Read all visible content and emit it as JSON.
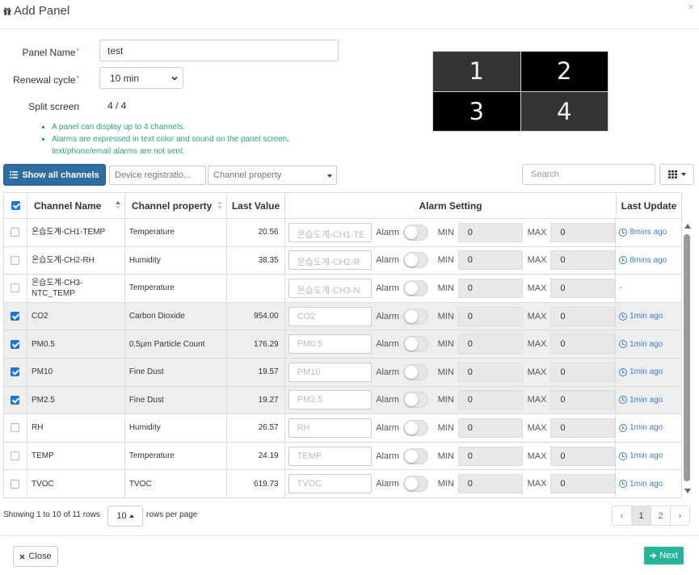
{
  "modal": {
    "title": "Add Panel",
    "close_glyph": "×",
    "icon": "gift-icon"
  },
  "form": {
    "panel_name_label": "Panel Name",
    "panel_name_value": "test",
    "renewal_label": "Renewal cycle",
    "renewal_value": "10 min",
    "split_label": "Split screen",
    "split_value": "4 / 4",
    "required_mark": "*",
    "notes": [
      "A panel can display up to 4 channels.",
      "Alarms are expressed in text color and sound on the panel screen, text/phone/email alarms are not sent."
    ]
  },
  "preview": {
    "cells": [
      "1",
      "2",
      "3",
      "4"
    ]
  },
  "toolbar": {
    "show_all_label": "Show all channels",
    "device_filter_placeholder": "Device registratio...",
    "property_filter_placeholder": "Channel property",
    "search_placeholder": "Search"
  },
  "table": {
    "headers": {
      "name": "Channel Name",
      "property": "Channel property",
      "last_value": "Last Value",
      "alarm": "Alarm Setting",
      "last_update": "Last Update"
    },
    "alarm_label": "Alarm",
    "min_label": "MIN",
    "max_label": "MAX",
    "rows": [
      {
        "checked": false,
        "name": "온습도계-CH1-TEMP",
        "property": "Temperature",
        "value": "20.56",
        "alias": "온습도계-CH1-TE",
        "min": "0",
        "max": "0",
        "update": "8mins ago"
      },
      {
        "checked": false,
        "name": "온습도계-CH2-RH",
        "property": "Humidity",
        "value": "38.35",
        "alias": "온습도계-CH2-R",
        "min": "0",
        "max": "0",
        "update": "8mins ago"
      },
      {
        "checked": false,
        "name": "온습도계-CH3-NTC_TEMP",
        "property": "Temperature",
        "value": "",
        "alias": "온습도계-CH3-N",
        "min": "0",
        "max": "0",
        "update": "-"
      },
      {
        "checked": true,
        "name": "CO2",
        "property": "Carbon Dioxide",
        "value": "954.00",
        "alias": "CO2",
        "min": "0",
        "max": "0",
        "update": "1min ago"
      },
      {
        "checked": true,
        "name": "PM0.5",
        "property": "0.5μm Particle Count",
        "value": "176.29",
        "alias": "PM0.5",
        "min": "0",
        "max": "0",
        "update": "1min ago"
      },
      {
        "checked": true,
        "name": "PM10",
        "property": "Fine Dust",
        "value": "19.57",
        "alias": "PM10",
        "min": "0",
        "max": "0",
        "update": "1min ago"
      },
      {
        "checked": true,
        "name": "PM2.5",
        "property": "Fine Dust",
        "value": "19.27",
        "alias": "PM2.5",
        "min": "0",
        "max": "0",
        "update": "1min ago"
      },
      {
        "checked": false,
        "name": "RH",
        "property": "Humidity",
        "value": "26.57",
        "alias": "RH",
        "min": "0",
        "max": "0",
        "update": "1min ago"
      },
      {
        "checked": false,
        "name": "TEMP",
        "property": "Temperature",
        "value": "24.19",
        "alias": "TEMP",
        "min": "0",
        "max": "0",
        "update": "1min ago"
      },
      {
        "checked": false,
        "name": "TVOC",
        "property": "TVOC",
        "value": "619.73",
        "alias": "TVOC",
        "min": "0",
        "max": "0",
        "update": "1min ago"
      }
    ]
  },
  "pagination": {
    "info": "Showing 1 to 10 of 11 rows",
    "page_size": "10",
    "rows_per_page": "rows per page",
    "prev": "‹",
    "pages": [
      "1",
      "2"
    ],
    "next": "›"
  },
  "footer": {
    "close_label": "Close",
    "next_label": "Next"
  },
  "colors": {
    "primary": "#2e6da4",
    "success": "#26b59a",
    "note_text": "#2aa389",
    "link": "#3b7fd6",
    "required": "#d9534f"
  }
}
